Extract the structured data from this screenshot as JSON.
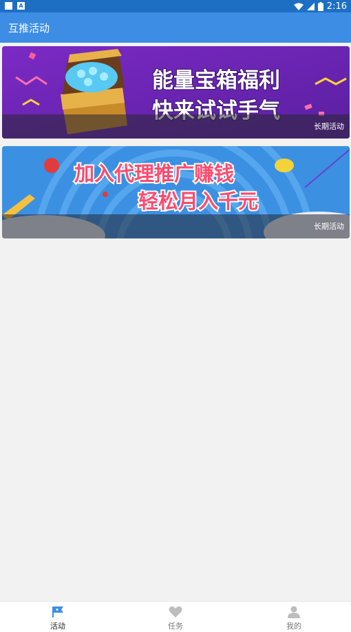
{
  "status_bar": {
    "time": "2:16"
  },
  "app_bar": {
    "title": "互推活动"
  },
  "banners": [
    {
      "line1": "能量宝箱福利",
      "line2": "快来试试手气",
      "tag": "长期活动"
    },
    {
      "line1": "加入代理推广赚钱",
      "line2": "轻松月入千元",
      "tag": "长期活动"
    }
  ],
  "bottom_nav": {
    "items": [
      {
        "label": "活动",
        "icon": "flag-icon",
        "active": true
      },
      {
        "label": "任务",
        "icon": "heart-icon",
        "active": false
      },
      {
        "label": "我的",
        "icon": "person-icon",
        "active": false
      }
    ]
  },
  "colors": {
    "status_bar": "#1d6fc4",
    "app_bar": "#3d8de4",
    "active_icon": "#3d8de4",
    "inactive_icon": "#bdbdbd"
  }
}
